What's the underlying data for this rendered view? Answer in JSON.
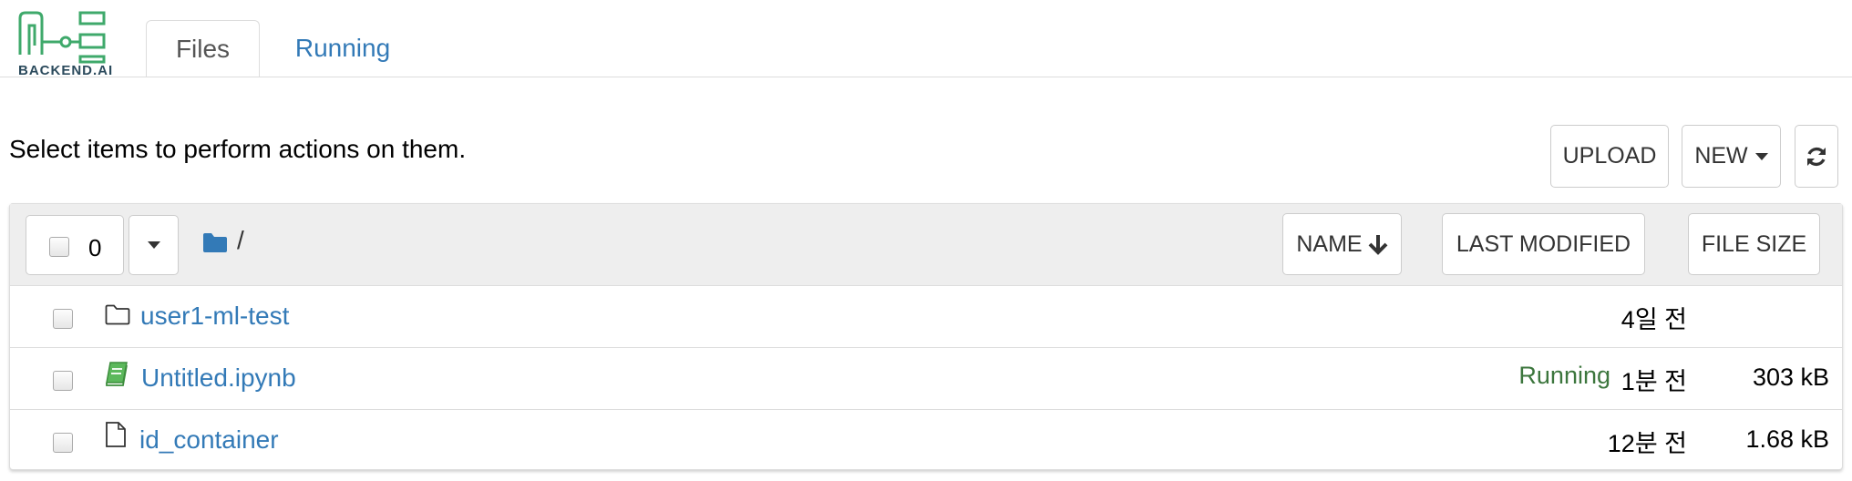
{
  "brand": {
    "logo_text": "BACKEND.AI"
  },
  "tabs": [
    {
      "label": "Files",
      "active": true
    },
    {
      "label": "Running",
      "active": false
    }
  ],
  "toolbar": {
    "hint": "Select items to perform actions on them.",
    "upload_label": "UPLOAD",
    "new_label": "NEW",
    "refresh_icon": "refresh-icon"
  },
  "list_header": {
    "selected_count": "0",
    "path": "/",
    "sort_name_label": "NAME",
    "sort_name_icon": "arrow-down-icon",
    "last_modified_label": "LAST MODIFIED",
    "file_size_label": "FILE SIZE"
  },
  "items": [
    {
      "icon": "folder-outline-icon",
      "name": "user1-ml-test",
      "status": "",
      "modified": "4일 전",
      "size": ""
    },
    {
      "icon": "notebook-icon",
      "name": "Untitled.ipynb",
      "status": "Running",
      "modified": "1분 전",
      "size": "303 kB"
    },
    {
      "icon": "file-icon",
      "name": "id_container",
      "status": "",
      "modified": "12분 전",
      "size": "1.68 kB"
    }
  ],
  "colors": {
    "link": "#337ab7",
    "running": "#3c763d",
    "logo": "#3fa96b",
    "folder": "#337ab7"
  }
}
